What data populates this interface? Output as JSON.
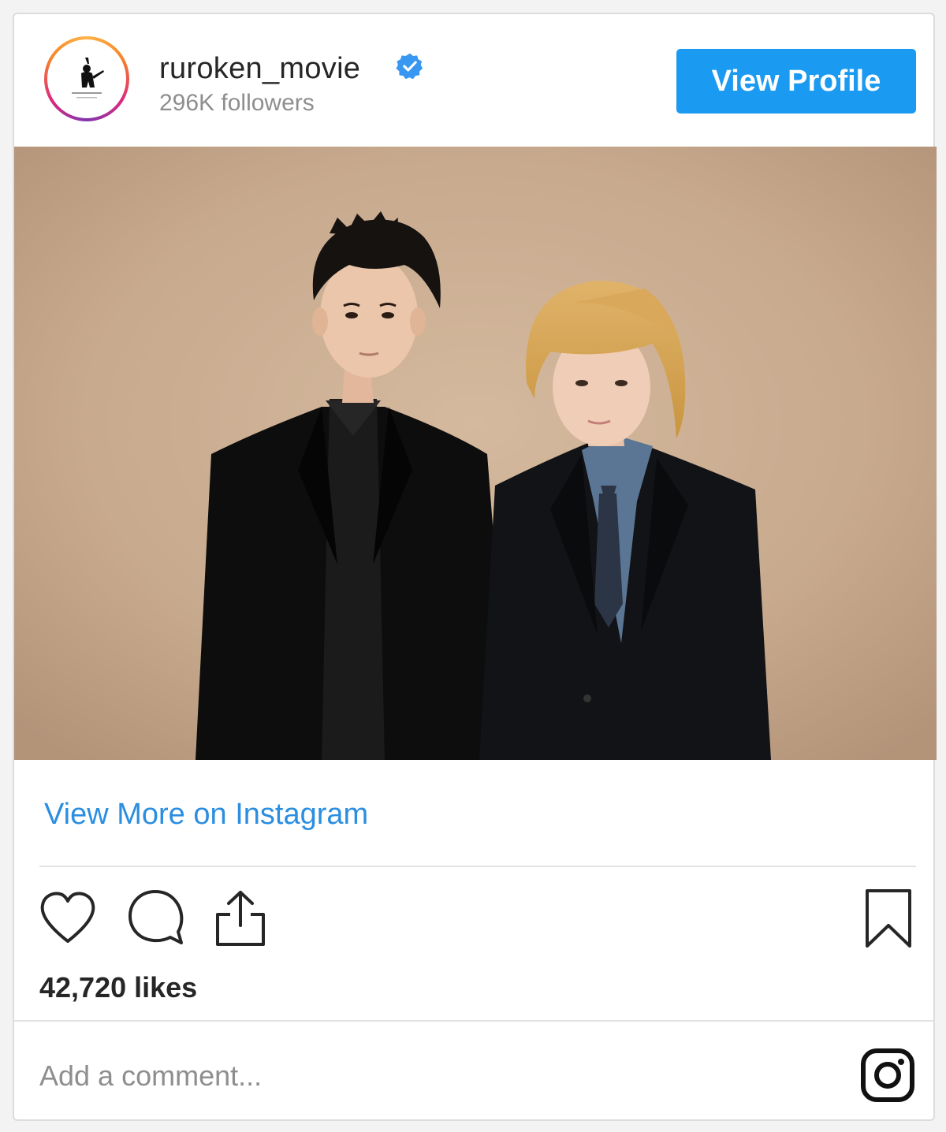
{
  "header": {
    "username": "ruroken_movie",
    "verified_icon": "verified-badge-icon",
    "followers": "296K followers",
    "view_profile_label": "View Profile"
  },
  "post": {
    "photo": "two-people-portrait-image",
    "view_more_label": "View More on Instagram",
    "likes": "42,720 likes",
    "comment_placeholder": "Add a comment..."
  },
  "icons": {
    "like": "heart-icon",
    "comment": "comment-bubble-icon",
    "share": "share-icon",
    "save": "bookmark-icon",
    "instagram": "instagram-logo-icon"
  },
  "colors": {
    "accent": "#1a9af0",
    "link": "#2b8ee0",
    "text": "#262626",
    "muted": "#8e8e8e"
  }
}
